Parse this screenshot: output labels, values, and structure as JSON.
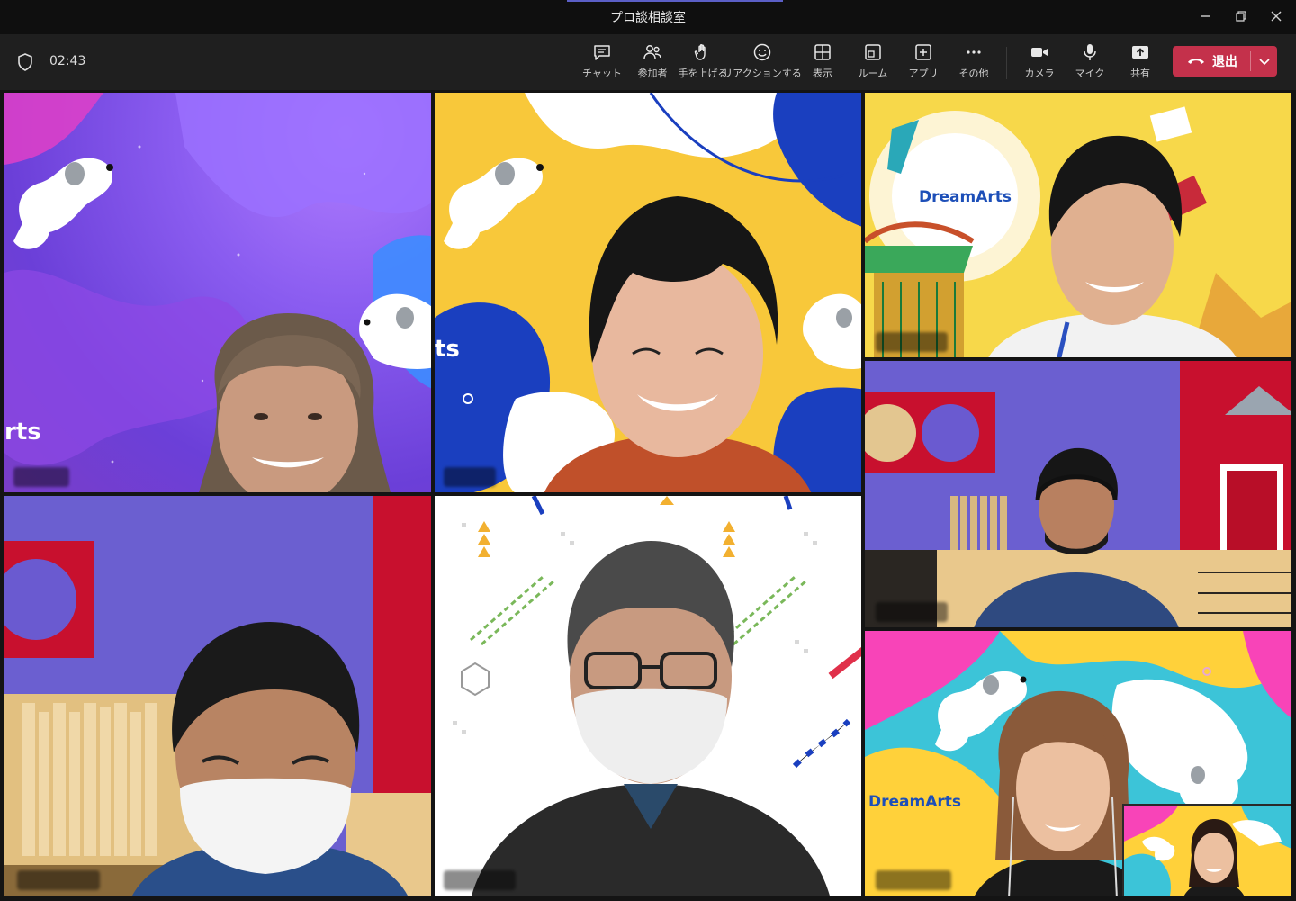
{
  "window": {
    "title": "プロ談相談室",
    "minimize_icon": "minimize-icon",
    "restore_icon": "restore-icon",
    "close_icon": "close-icon"
  },
  "toolbar": {
    "timer": "02:43",
    "items": [
      {
        "id": "chat",
        "label": "チャット",
        "icon": "chat-icon"
      },
      {
        "id": "participants",
        "label": "参加者",
        "icon": "people-icon"
      },
      {
        "id": "raise-hand",
        "label": "手を上げる",
        "icon": "hand-icon"
      },
      {
        "id": "reactions",
        "label": "リアクションする",
        "icon": "smiley-icon"
      },
      {
        "id": "view",
        "label": "表示",
        "icon": "grid-icon"
      },
      {
        "id": "rooms",
        "label": "ルーム",
        "icon": "rooms-icon"
      },
      {
        "id": "apps",
        "label": "アプリ",
        "icon": "plus-box-icon"
      },
      {
        "id": "more",
        "label": "その他",
        "icon": "more-icon"
      },
      {
        "id": "camera",
        "label": "カメラ",
        "icon": "camera-icon"
      },
      {
        "id": "mic",
        "label": "マイク",
        "icon": "mic-icon"
      },
      {
        "id": "share",
        "label": "共有",
        "icon": "share-icon"
      }
    ],
    "leave_label": "退出"
  },
  "tiles": {
    "brand_full": "DreamArts",
    "brand_partial_1": "rts",
    "brand_partial_2": "ts"
  },
  "colors": {
    "leave": "#c4314b",
    "purple_bg": "#8a5cf0",
    "yellow_bg": "#f8c83a",
    "room_wall": "#6b5fd0",
    "room_red": "#c8102e",
    "accent": "#5b5fc7"
  }
}
